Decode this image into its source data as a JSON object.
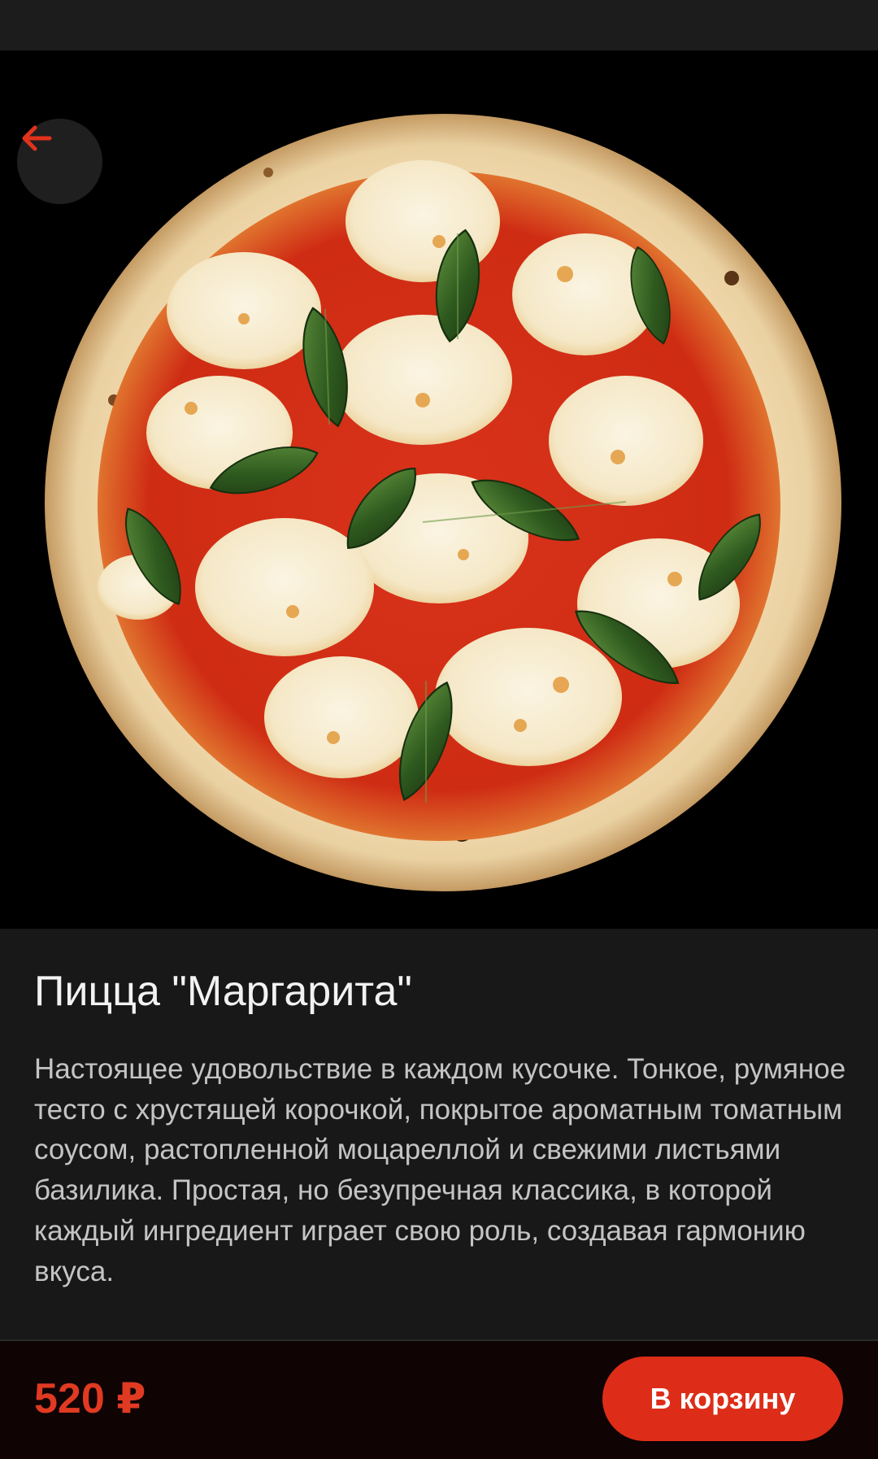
{
  "header": {
    "back_icon": "arrow-left-icon"
  },
  "product": {
    "image_icon": "pizza-margherita-photo",
    "title": "Пицца \"Маргарита\"",
    "description": "Настоящее удовольствие в каждом кусочке. Тонкое, румяное тесто с хрустящей корочкой, покрытое ароматным томатным соусом, растопленной моцареллой и свежими листьями базилика. Простая, но безупречная классика, в которой каждый ингредиент играет свою роль, создавая гармонию вкуса."
  },
  "footer": {
    "price": "520 ₽",
    "cart_button_label": "В корзину"
  },
  "colors": {
    "accent": "#dd2d18",
    "price": "#e03a22",
    "background": "#181818",
    "hero_background": "#000000",
    "bottom_bar": "#0f0303"
  }
}
